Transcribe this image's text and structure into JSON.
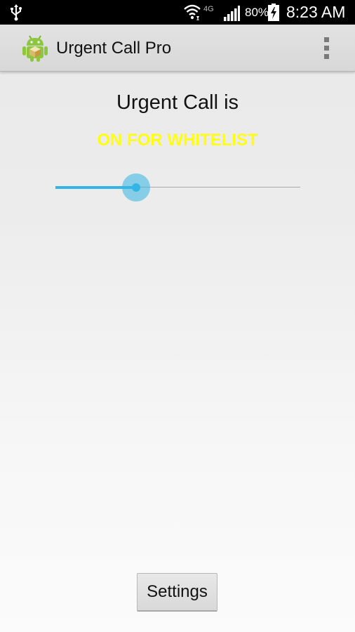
{
  "status_bar": {
    "network_type": "4G",
    "battery_percent": "80%",
    "time": "8:23 AM",
    "icons": [
      "usb-icon",
      "wifi-icon",
      "signal-icon",
      "battery-charging-icon"
    ]
  },
  "action_bar": {
    "title": "Urgent Call Pro",
    "icon": "android-app-icon",
    "overflow_icon": "overflow-menu-icon"
  },
  "main": {
    "status_label": "Urgent Call is",
    "mode_label": "ON FOR WHITELIST",
    "mode_color": "#ffff14",
    "slider": {
      "value": 0.33,
      "accent_color": "#33b5e5"
    },
    "settings_label": "Settings"
  }
}
